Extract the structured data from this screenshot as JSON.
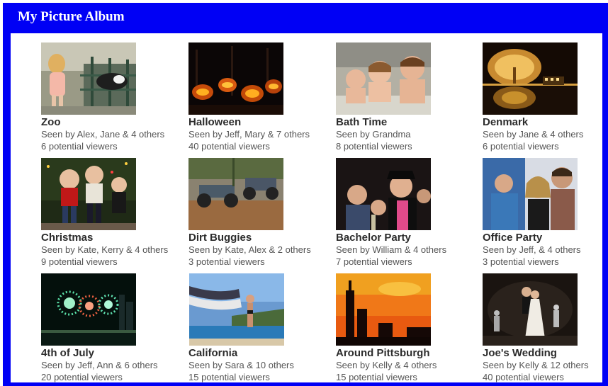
{
  "window": {
    "title": "My Picture Album"
  },
  "colors": {
    "title_bar": "#0000f5",
    "album_title": "#2c2c2c",
    "meta_text": "#555555"
  },
  "scrollbar": {
    "up_icon": "▲",
    "down_icon": "▼"
  },
  "albums": [
    {
      "title": "Zoo",
      "seen": "Seen by Alex, Jane & 4 others",
      "viewers": "6 potential viewers",
      "photo": "girl at zoo with goats"
    },
    {
      "title": "Halloween",
      "seen": "Seen by Jeff, Mary & 7 others",
      "viewers": "40 potential viewers",
      "photo": "glowing jack-o-lanterns"
    },
    {
      "title": "Bath Time",
      "seen": "Seen by Grandma",
      "viewers": "8 potential viewers",
      "photo": "kids in bathtub"
    },
    {
      "title": "Denmark",
      "seen": "Seen by Jane & 4 others",
      "viewers": "6 potential viewers",
      "photo": "lit tree at night over water"
    },
    {
      "title": "Christmas",
      "seen": "Seen by Kate, Kerry & 4 others",
      "viewers": "9 potential viewers",
      "photo": "children by christmas tree"
    },
    {
      "title": "Dirt Buggies",
      "seen": "Seen by Kate, Alex & 2 others",
      "viewers": "3 potential viewers",
      "photo": "dune buggies in dirt"
    },
    {
      "title": "Bachelor Party",
      "seen": "Seen by William & 4 others",
      "viewers": "7 potential viewers",
      "photo": "group of men at party"
    },
    {
      "title": "Office Party",
      "seen": "Seen by Jeff, & 4 others",
      "viewers": "3 potential viewers",
      "photo": "coworkers at party"
    },
    {
      "title": "4th of July",
      "seen": "Seen by Jeff, Ann & 6 others",
      "viewers": "20 potential viewers",
      "photo": "fireworks over city"
    },
    {
      "title": "California",
      "seen": "Seen by Sara & 10 others",
      "viewers": "15 potential viewers",
      "photo": "woman with flag at beach"
    },
    {
      "title": "Around Pittsburgh",
      "seen": "Seen by Kelly & 4 others",
      "viewers": "15 potential viewers",
      "photo": "skyline silhouette at sunset"
    },
    {
      "title": "Joe's Wedding",
      "seen": "Seen by Kelly & 12 others",
      "viewers": "40 potential viewers",
      "photo": "couple dancing at wedding"
    }
  ]
}
